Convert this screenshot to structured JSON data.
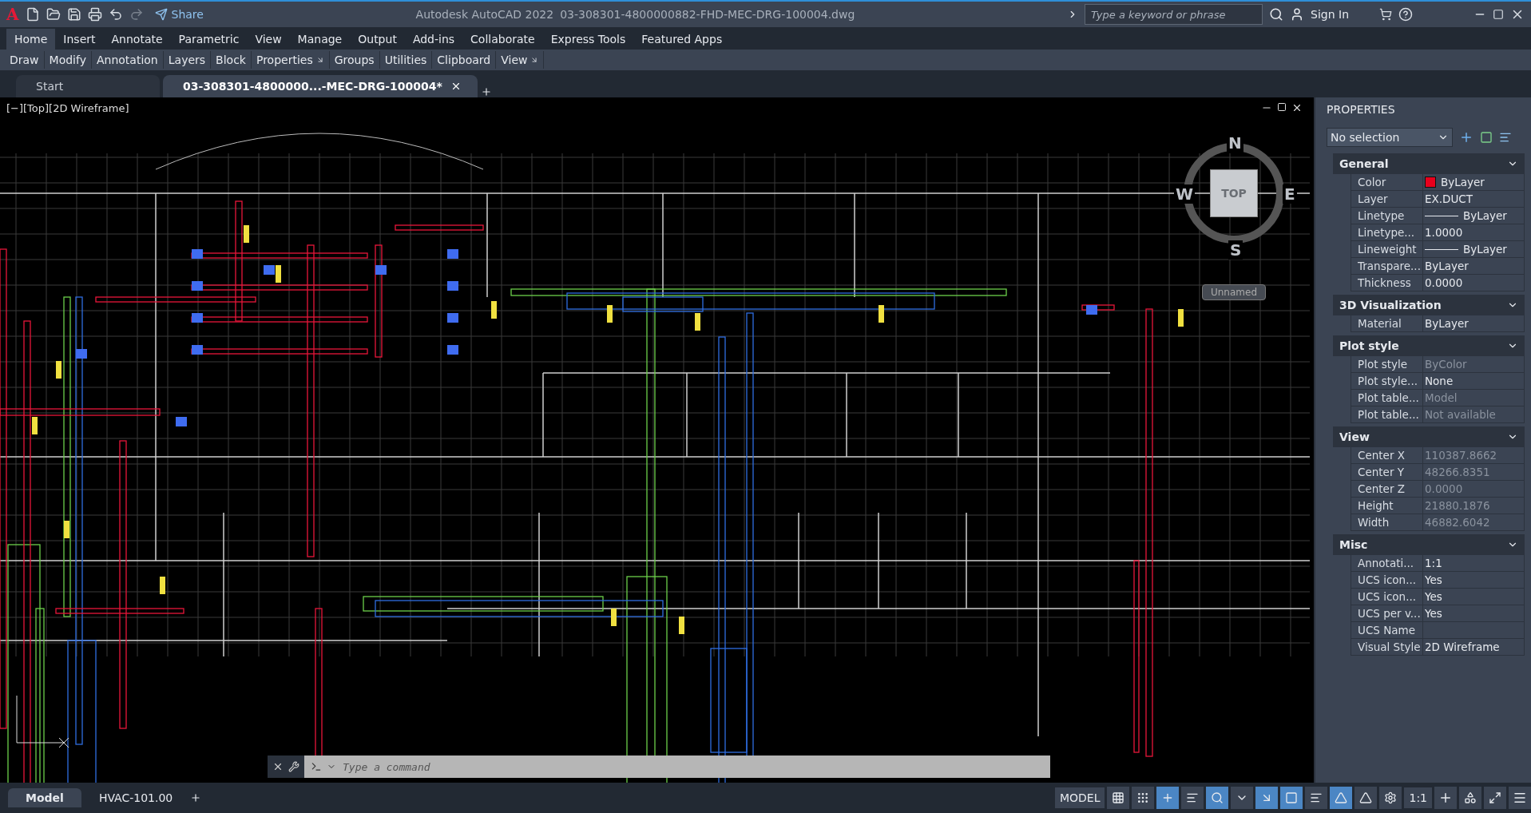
{
  "title_bar": {
    "logo": "A",
    "share": "Share",
    "app_name": "Autodesk AutoCAD 2022",
    "file_name": "03-308301-4800000882-FHD-MEC-DRG-100004.dwg",
    "search": {
      "placeholder": "Type a keyword or phrase"
    },
    "sign_in": "Sign In"
  },
  "ribbon_tabs": [
    {
      "label": "Home",
      "selected": true
    },
    {
      "label": "Insert",
      "selected": false
    },
    {
      "label": "Annotate",
      "selected": false
    },
    {
      "label": "Parametric",
      "selected": false
    },
    {
      "label": "View",
      "selected": false
    },
    {
      "label": "Manage",
      "selected": false
    },
    {
      "label": "Output",
      "selected": false
    },
    {
      "label": "Add-ins",
      "selected": false
    },
    {
      "label": "Collaborate",
      "selected": false
    },
    {
      "label": "Express Tools",
      "selected": false
    },
    {
      "label": "Featured Apps",
      "selected": false
    }
  ],
  "ribbon_panels": [
    {
      "label": "Draw",
      "launcher": false
    },
    {
      "label": "Modify",
      "launcher": false
    },
    {
      "label": "Annotation",
      "launcher": false
    },
    {
      "label": "Layers",
      "launcher": false
    },
    {
      "label": "Block",
      "launcher": false
    },
    {
      "label": "Properties",
      "launcher": true
    },
    {
      "label": "Groups",
      "launcher": false
    },
    {
      "label": "Utilities",
      "launcher": false
    },
    {
      "label": "Clipboard",
      "launcher": false
    },
    {
      "label": "View",
      "launcher": true
    }
  ],
  "doc_tabs": [
    {
      "label": "Start",
      "selected": false,
      "closable": false
    },
    {
      "label": "03-308301-4800000...-MEC-DRG-100004*",
      "selected": true,
      "closable": true
    }
  ],
  "viewport": {
    "label": "[−][Top][2D Wireframe]",
    "viewcube": {
      "north": "N",
      "south": "S",
      "west": "W",
      "east": "E",
      "face": "TOP",
      "ucs": "Unnamed"
    }
  },
  "command_line": {
    "placeholder": "Type a command"
  },
  "layout_tabs": [
    {
      "label": "Model",
      "selected": true
    },
    {
      "label": "HVAC-101.00",
      "selected": false
    }
  ],
  "status_bar": {
    "mode": "MODEL",
    "toggles": [
      {
        "on": false
      },
      {
        "on": false
      },
      {
        "on": true
      },
      {
        "on": false
      },
      {
        "on": true
      },
      {
        "on": false
      },
      {
        "on": true
      },
      {
        "on": true
      },
      {
        "on": false
      },
      {
        "on": true
      },
      {
        "on": false
      },
      {
        "on": false
      }
    ],
    "scale": "1:1"
  },
  "properties": {
    "title": "PROPERTIES",
    "selection": "No selection",
    "sections": [
      {
        "title": "General",
        "expanded": true,
        "rows": [
          {
            "kind": "color",
            "label": "Color",
            "value": "ByLayer",
            "color": "#e8001c",
            "disabled": false
          },
          {
            "kind": "text",
            "label": "Layer",
            "value": "EX.DUCT",
            "disabled": false
          },
          {
            "kind": "line",
            "label": "Linetype",
            "value": "ByLayer",
            "disabled": false
          },
          {
            "kind": "text",
            "label": "Linetype...",
            "value": "1.0000",
            "disabled": false
          },
          {
            "kind": "line",
            "label": "Lineweight",
            "value": "ByLayer",
            "disabled": false
          },
          {
            "kind": "text",
            "label": "Transpare...",
            "value": "ByLayer",
            "disabled": false
          },
          {
            "kind": "text",
            "label": "Thickness",
            "value": "0.0000",
            "disabled": false
          }
        ]
      },
      {
        "title": "3D Visualization",
        "expanded": true,
        "rows": [
          {
            "kind": "text",
            "label": "Material",
            "value": "ByLayer",
            "disabled": false
          }
        ]
      },
      {
        "title": "Plot style",
        "expanded": true,
        "rows": [
          {
            "kind": "text",
            "label": "Plot style",
            "value": "ByColor",
            "disabled": true
          },
          {
            "kind": "text",
            "label": "Plot style...",
            "value": "None",
            "disabled": false
          },
          {
            "kind": "text",
            "label": "Plot table...",
            "value": "Model",
            "disabled": true
          },
          {
            "kind": "text",
            "label": "Plot table...",
            "value": "Not available",
            "disabled": true
          }
        ]
      },
      {
        "title": "View",
        "expanded": true,
        "rows": [
          {
            "kind": "text",
            "label": "Center X",
            "value": "110387.8662",
            "disabled": true
          },
          {
            "kind": "text",
            "label": "Center Y",
            "value": "48266.8351",
            "disabled": true
          },
          {
            "kind": "text",
            "label": "Center Z",
            "value": "0.0000",
            "disabled": true
          },
          {
            "kind": "text",
            "label": "Height",
            "value": "21880.1876",
            "disabled": true
          },
          {
            "kind": "text",
            "label": "Width",
            "value": "46882.6042",
            "disabled": true
          }
        ]
      },
      {
        "title": "Misc",
        "expanded": true,
        "rows": [
          {
            "kind": "text",
            "label": "Annotati...",
            "value": "1:1",
            "disabled": false
          },
          {
            "kind": "text",
            "label": "UCS icon...",
            "value": "Yes",
            "disabled": false
          },
          {
            "kind": "text",
            "label": "UCS icon...",
            "value": "Yes",
            "disabled": false
          },
          {
            "kind": "text",
            "label": "UCS per v...",
            "value": "Yes",
            "disabled": false
          },
          {
            "kind": "text",
            "label": "UCS Name",
            "disabled": false
          },
          {
            "kind": "text",
            "label": "Visual Style",
            "value": "2D Wireframe",
            "disabled": false
          }
        ]
      }
    ]
  }
}
